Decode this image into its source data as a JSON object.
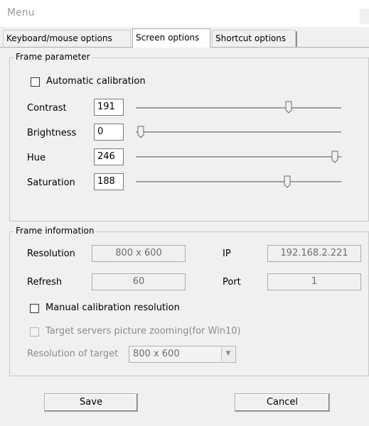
{
  "window": {
    "title": "Menu"
  },
  "tabs": [
    {
      "label": "Keyboard/mouse options",
      "active": false
    },
    {
      "label": "Screen options",
      "active": true
    },
    {
      "label": "Shortcut options",
      "active": false
    }
  ],
  "frame_parameter": {
    "legend": "Frame parameter",
    "auto_calibration": {
      "label": "Automatic calibration",
      "checked": false
    },
    "sliders": [
      {
        "label": "Contrast",
        "value": "191",
        "level": 0.75
      },
      {
        "label": "Brightness",
        "value": "0",
        "level": 0.0
      },
      {
        "label": "Hue",
        "value": "246",
        "level": 1.0
      },
      {
        "label": "Saturation",
        "value": "188",
        "level": 0.74
      }
    ]
  },
  "frame_information": {
    "legend": "Frame information",
    "resolution": {
      "label": "Resolution",
      "value": "800 x 600"
    },
    "ip": {
      "label": "IP",
      "value": "192.168.2.221"
    },
    "refresh": {
      "label": "Refresh",
      "value": "60"
    },
    "port": {
      "label": "Port",
      "value": "1"
    },
    "manual_calibration": {
      "label": "Manual calibration resolution",
      "checked": false
    },
    "zooming": {
      "label": "Target servers picture zooming(for Win10)",
      "checked": false,
      "enabled": false
    },
    "target_resolution": {
      "label": "Resolution of target",
      "value": "800 x 600",
      "enabled": false
    }
  },
  "buttons": {
    "save": "Save",
    "cancel": "Cancel"
  }
}
